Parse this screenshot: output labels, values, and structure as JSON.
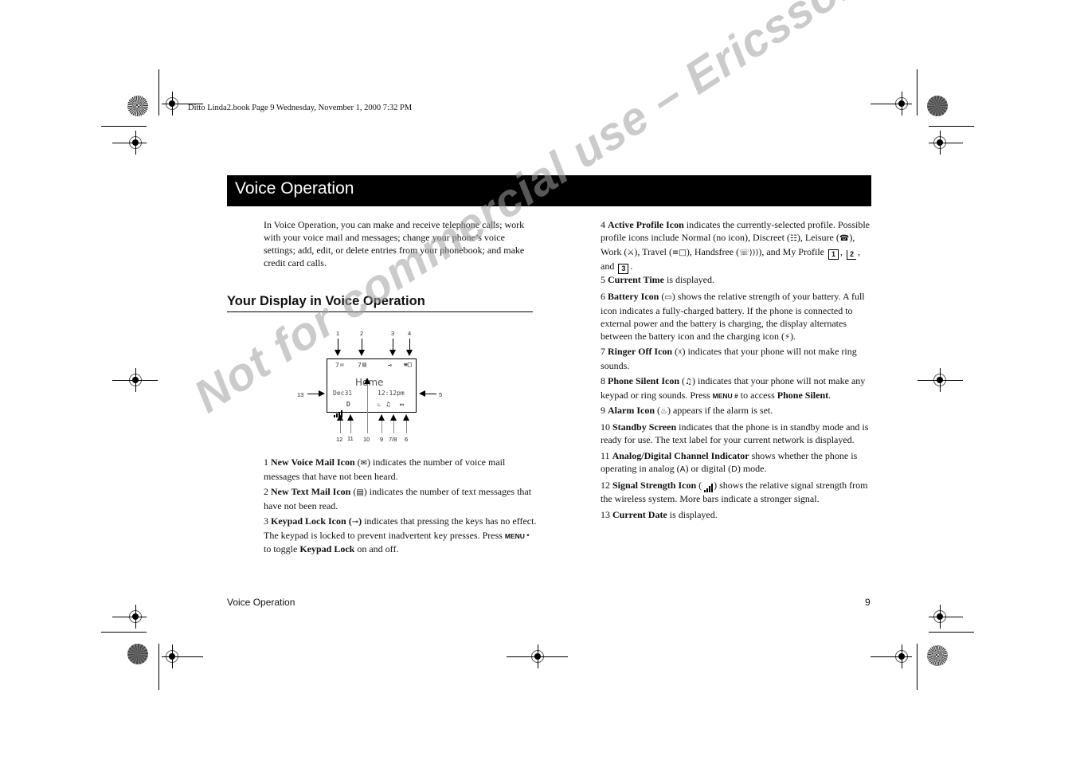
{
  "print_header": "Ditto Linda2.book  Page 9  Wednesday, November 1, 2000  7:32 PM",
  "chapter_title": "Voice Operation",
  "intro": "In Voice Operation, you can make and receive telephone calls; work with your voice mail and messages; change your phone’s voice settings; add, edit, or delete entries from your phonebook; and make credit card calls.",
  "section_heading": "Your Display in Voice Operation",
  "display": {
    "voicemail_count": "7",
    "textmail_count": "7",
    "network_label": "Home",
    "date": "Dec31",
    "time": "12:12pm",
    "channel_mode": "D",
    "callouts_top": [
      "1",
      "2",
      "3",
      "4"
    ],
    "callout_left": "13",
    "callout_right": "5",
    "callouts_bottom": [
      "12",
      "11",
      "10",
      "9",
      "7/8",
      "6"
    ]
  },
  "items": [
    {
      "num": "1",
      "term": "New Voice Mail Icon",
      "icon": "voicemail-icon",
      "text": "indicates the number of voice mail messages that have not been heard."
    },
    {
      "num": "2",
      "term": "New Text Mail Icon",
      "icon": "textmail-icon",
      "text": "indicates the number of text messages that have not been read."
    },
    {
      "num": "3",
      "term": "Keypad Lock Icon",
      "icon": "key-icon",
      "text_a": "indicates that pressing the keys has no effect. The keypad is locked to prevent inadvertent key presses. Press",
      "key": "MENU *",
      "text_b": "to toggle",
      "term2": "Keypad Lock",
      "text_c": "on and off."
    },
    {
      "num": "4",
      "term": "Active Profile Icon",
      "text_a": "indicates the currently-selected profile. Possible profile icons include Normal (no icon), Discreet (",
      "text_b": "), Leisure (",
      "text_c": "), Work (",
      "text_d": "), Travel (",
      "text_e": "), Handsfree (",
      "text_f": "), and My Profile",
      "profiles": [
        "1",
        "2",
        "3"
      ],
      "sep1": ",",
      "and": ", and",
      "end": "."
    },
    {
      "num": "5",
      "term": "Current Time",
      "text": "is displayed."
    },
    {
      "num": "6",
      "term": "Battery Icon",
      "icon": "battery-icon",
      "text": "shows the relative strength of your battery. A full icon indicates a fully-charged battery. If the phone is connected to external power and the battery is charging, the display alternates between the battery icon and the charging icon (",
      "end": ")."
    },
    {
      "num": "7",
      "term": "Ringer Off Icon",
      "icon": "ringer-off-icon",
      "text": "indicates that your phone will not make ring sounds."
    },
    {
      "num": "8",
      "term": "Phone Silent Icon",
      "icon": "phone-silent-icon",
      "text_a": "indicates that your phone will not make any keypad or ring sounds. Press",
      "key": "MENU #",
      "text_b": "to access",
      "term2": "Phone Silent",
      "end": "."
    },
    {
      "num": "9",
      "term": "Alarm Icon",
      "icon": "alarm-icon",
      "text": "appears if the alarm is set."
    },
    {
      "num": "10",
      "term": "Standby Screen",
      "text": "indicates that the phone is in standby mode and is ready for use. The text label for your current network is displayed."
    },
    {
      "num": "11",
      "term": "Analog/Digital Channel Indicator",
      "text_a": "shows whether the phone is operating in analog (",
      "analog": "A",
      "text_b": ") or digital (",
      "digital": "D",
      "text_c": ") mode."
    },
    {
      "num": "12",
      "term": "Signal Strength Icon",
      "icon": "signal-strength-icon",
      "text": "shows the relative signal strength from the wireless system. More bars indicate a stronger signal."
    },
    {
      "num": "13",
      "term": "Current Date",
      "text": "is displayed."
    }
  ],
  "footer": {
    "section": "Voice Operation",
    "page": "9"
  },
  "watermark": "Not for commercial use – Ericsson Inc."
}
